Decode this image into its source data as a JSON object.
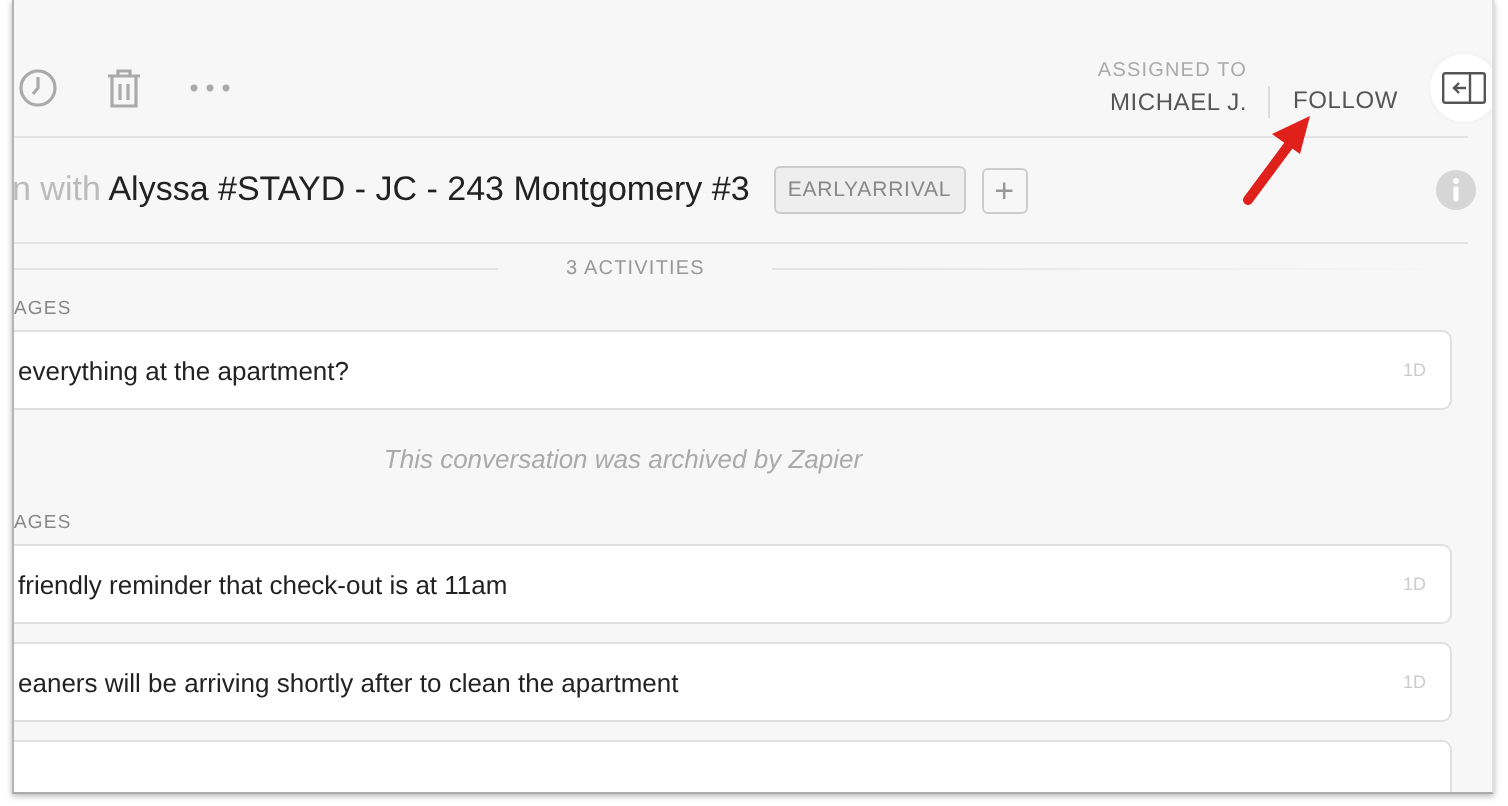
{
  "toolbar": {
    "assigned_label": "ASSIGNED TO",
    "assignee": "MICHAEL J.",
    "follow": "FOLLOW"
  },
  "header": {
    "prefix": "n with",
    "title": "Alyssa #STAYD - JC - 243 Montgomery #3",
    "tags": [
      "EARLYARRIVAL"
    ],
    "add": "+"
  },
  "activities_count": "3 ACTIVITIES",
  "activities": [
    {
      "kind": "section",
      "text": "AGES"
    },
    {
      "kind": "message",
      "text": "everything at the apartment?",
      "age": "1D"
    },
    {
      "kind": "note",
      "text": "This conversation was archived by Zapier"
    },
    {
      "kind": "section",
      "text": "AGES"
    },
    {
      "kind": "message",
      "text": "friendly reminder that check-out is at 11am",
      "age": "1D"
    },
    {
      "kind": "message",
      "text": "eaners will be arriving shortly after to clean the apartment",
      "age": "1D"
    },
    {
      "kind": "message"
    }
  ]
}
